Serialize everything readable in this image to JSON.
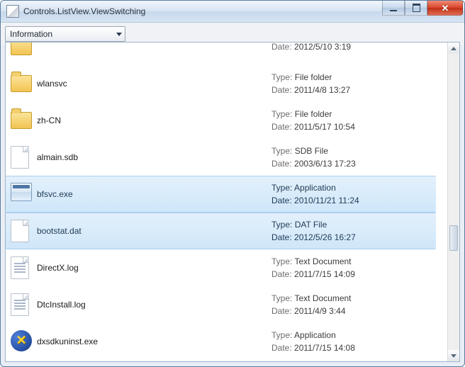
{
  "window": {
    "title": "Controls.ListView.ViewSwitching"
  },
  "toolbar": {
    "dropdown_value": "Information"
  },
  "labels": {
    "type": "Type:",
    "date": "Date:"
  },
  "items": [
    {
      "name": "",
      "icon": "folder",
      "type": "",
      "date": "2012/5/10 3:19",
      "selected": false,
      "cropped_top": true
    },
    {
      "name": "wlansvc",
      "icon": "folder",
      "type": "File folder",
      "date": "2011/4/8 13:27",
      "selected": false
    },
    {
      "name": "zh-CN",
      "icon": "folder",
      "type": "File folder",
      "date": "2011/5/17 10:54",
      "selected": false
    },
    {
      "name": "almain.sdb",
      "icon": "file",
      "type": "SDB File",
      "date": "2003/6/13 17:23",
      "selected": false
    },
    {
      "name": "bfsvc.exe",
      "icon": "app",
      "type": "Application",
      "date": "2010/11/21 11:24",
      "selected": true
    },
    {
      "name": "bootstat.dat",
      "icon": "file",
      "type": "DAT File",
      "date": "2012/5/26 16:27",
      "selected": true
    },
    {
      "name": "DirectX.log",
      "icon": "text",
      "type": "Text Document",
      "date": "2011/7/15 14:09",
      "selected": false
    },
    {
      "name": "DtcInstall.log",
      "icon": "text",
      "type": "Text Document",
      "date": "2011/4/9 3:44",
      "selected": false
    },
    {
      "name": "dxsdkuninst.exe",
      "icon": "dx",
      "type": "Application",
      "date": "2011/7/15 14:08",
      "selected": false
    }
  ]
}
